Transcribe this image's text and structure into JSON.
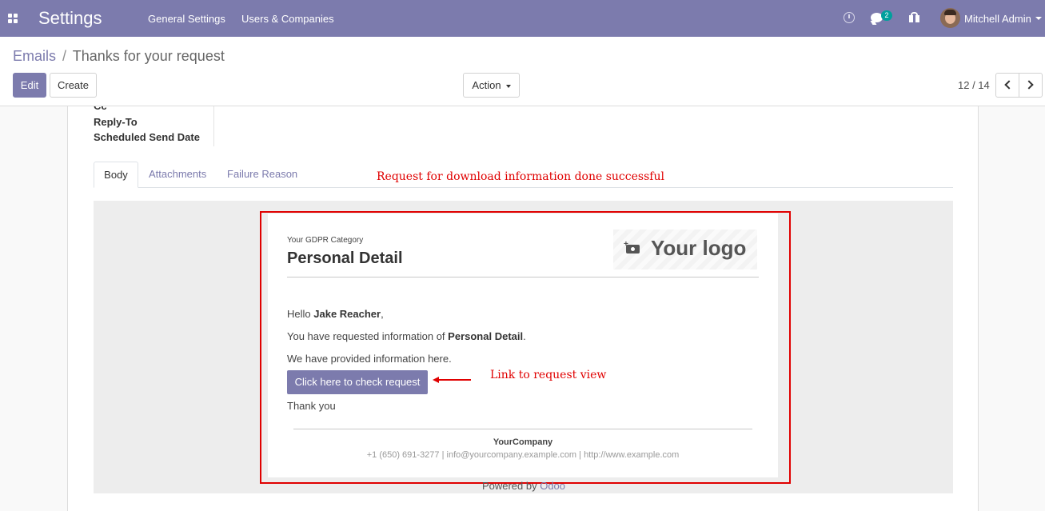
{
  "navbar": {
    "app_title": "Settings",
    "menu": [
      "General Settings",
      "Users & Companies"
    ],
    "chat_badge": "2",
    "user_name": "Mitchell Admin"
  },
  "breadcrumb": {
    "parent": "Emails",
    "separator": "/",
    "current": "Thanks for your request"
  },
  "toolbar": {
    "edit_label": "Edit",
    "create_label": "Create",
    "action_label": "Action",
    "pager": "12 / 14"
  },
  "form": {
    "fields": [
      "Cc",
      "Reply-To",
      "Scheduled Send Date"
    ],
    "tabs": [
      "Body",
      "Attachments",
      "Failure Reason"
    ],
    "active_tab": "Body"
  },
  "annotations": {
    "top": "Request for download information done successful",
    "link": "Link to request view"
  },
  "email": {
    "category": "Your GDPR Category",
    "title": "Personal Detail",
    "logo_text": "Your logo",
    "greeting_prefix": "Hello ",
    "recipient": "Jake Reacher",
    "greeting_suffix": ",",
    "request_prefix": "You have requested information of ",
    "request_item": "Personal Detail",
    "request_suffix": ".",
    "provided": "We have provided information here.",
    "button_label": "Click here to check request",
    "closing": "Thank you",
    "footer_company": "YourCompany",
    "footer_contact": "+1 (650) 691-3277 | info@yourcompany.example.com | http://www.example.com"
  },
  "powered": {
    "prefix": "Powered by ",
    "brand": "Odoo"
  },
  "colors": {
    "navbar": "#7c7bad",
    "accent": "#7c7bad",
    "annotation": "#e00000",
    "badge": "#00a09d"
  }
}
